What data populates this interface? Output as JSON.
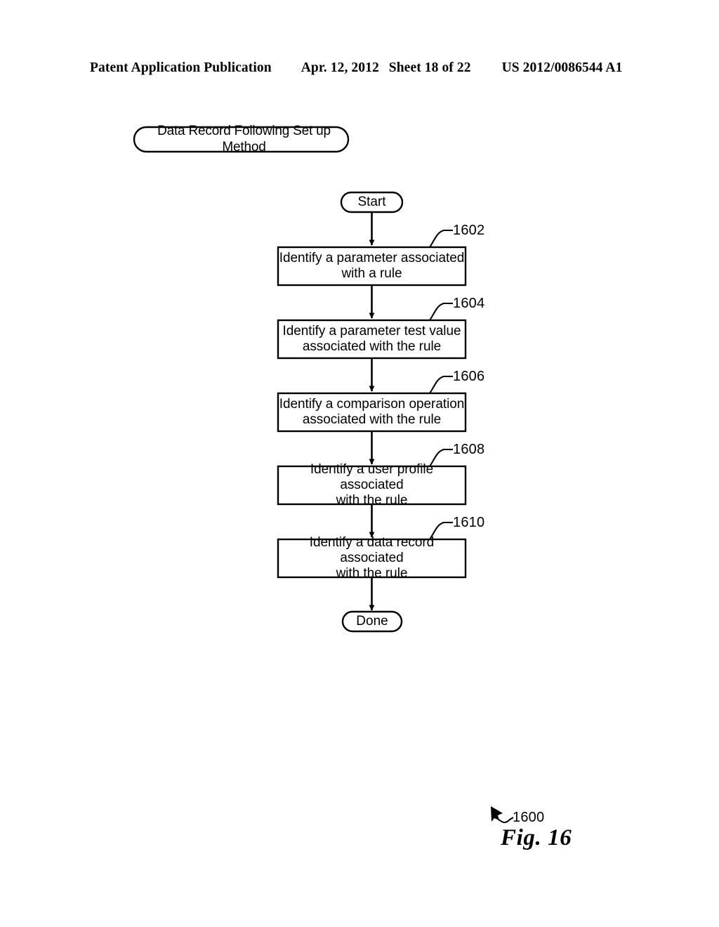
{
  "header": {
    "publication": "Patent Application Publication",
    "date": "Apr. 12, 2012",
    "sheet": "Sheet 18 of 22",
    "publication_number": "US 2012/0086544 A1"
  },
  "figure": {
    "caption": "Fig. 16",
    "figure_reference": "1600",
    "title_box": {
      "label": "Data Record Following Set up Method"
    },
    "nodes": [
      {
        "id": "start",
        "type": "terminator",
        "label": "Start",
        "ref": null
      },
      {
        "id": "step-1602",
        "type": "process",
        "label": "Identify a parameter associated\nwith a rule",
        "ref": "1602"
      },
      {
        "id": "step-1604",
        "type": "process",
        "label": "Identify a parameter test value\nassociated with the rule",
        "ref": "1604"
      },
      {
        "id": "step-1606",
        "type": "process",
        "label": "Identify a comparison operation\nassociated with the rule",
        "ref": "1606"
      },
      {
        "id": "step-1608",
        "type": "process",
        "label": "Identify a user profile associated\nwith the rule",
        "ref": "1608"
      },
      {
        "id": "step-1610",
        "type": "process",
        "label": "Identify a data record associated\nwith the rule",
        "ref": "1610"
      },
      {
        "id": "done",
        "type": "terminator",
        "label": "Done",
        "ref": null
      }
    ],
    "colors": {
      "stroke": "#000000",
      "fill": "#ffffff",
      "background": "#ffffff"
    }
  }
}
